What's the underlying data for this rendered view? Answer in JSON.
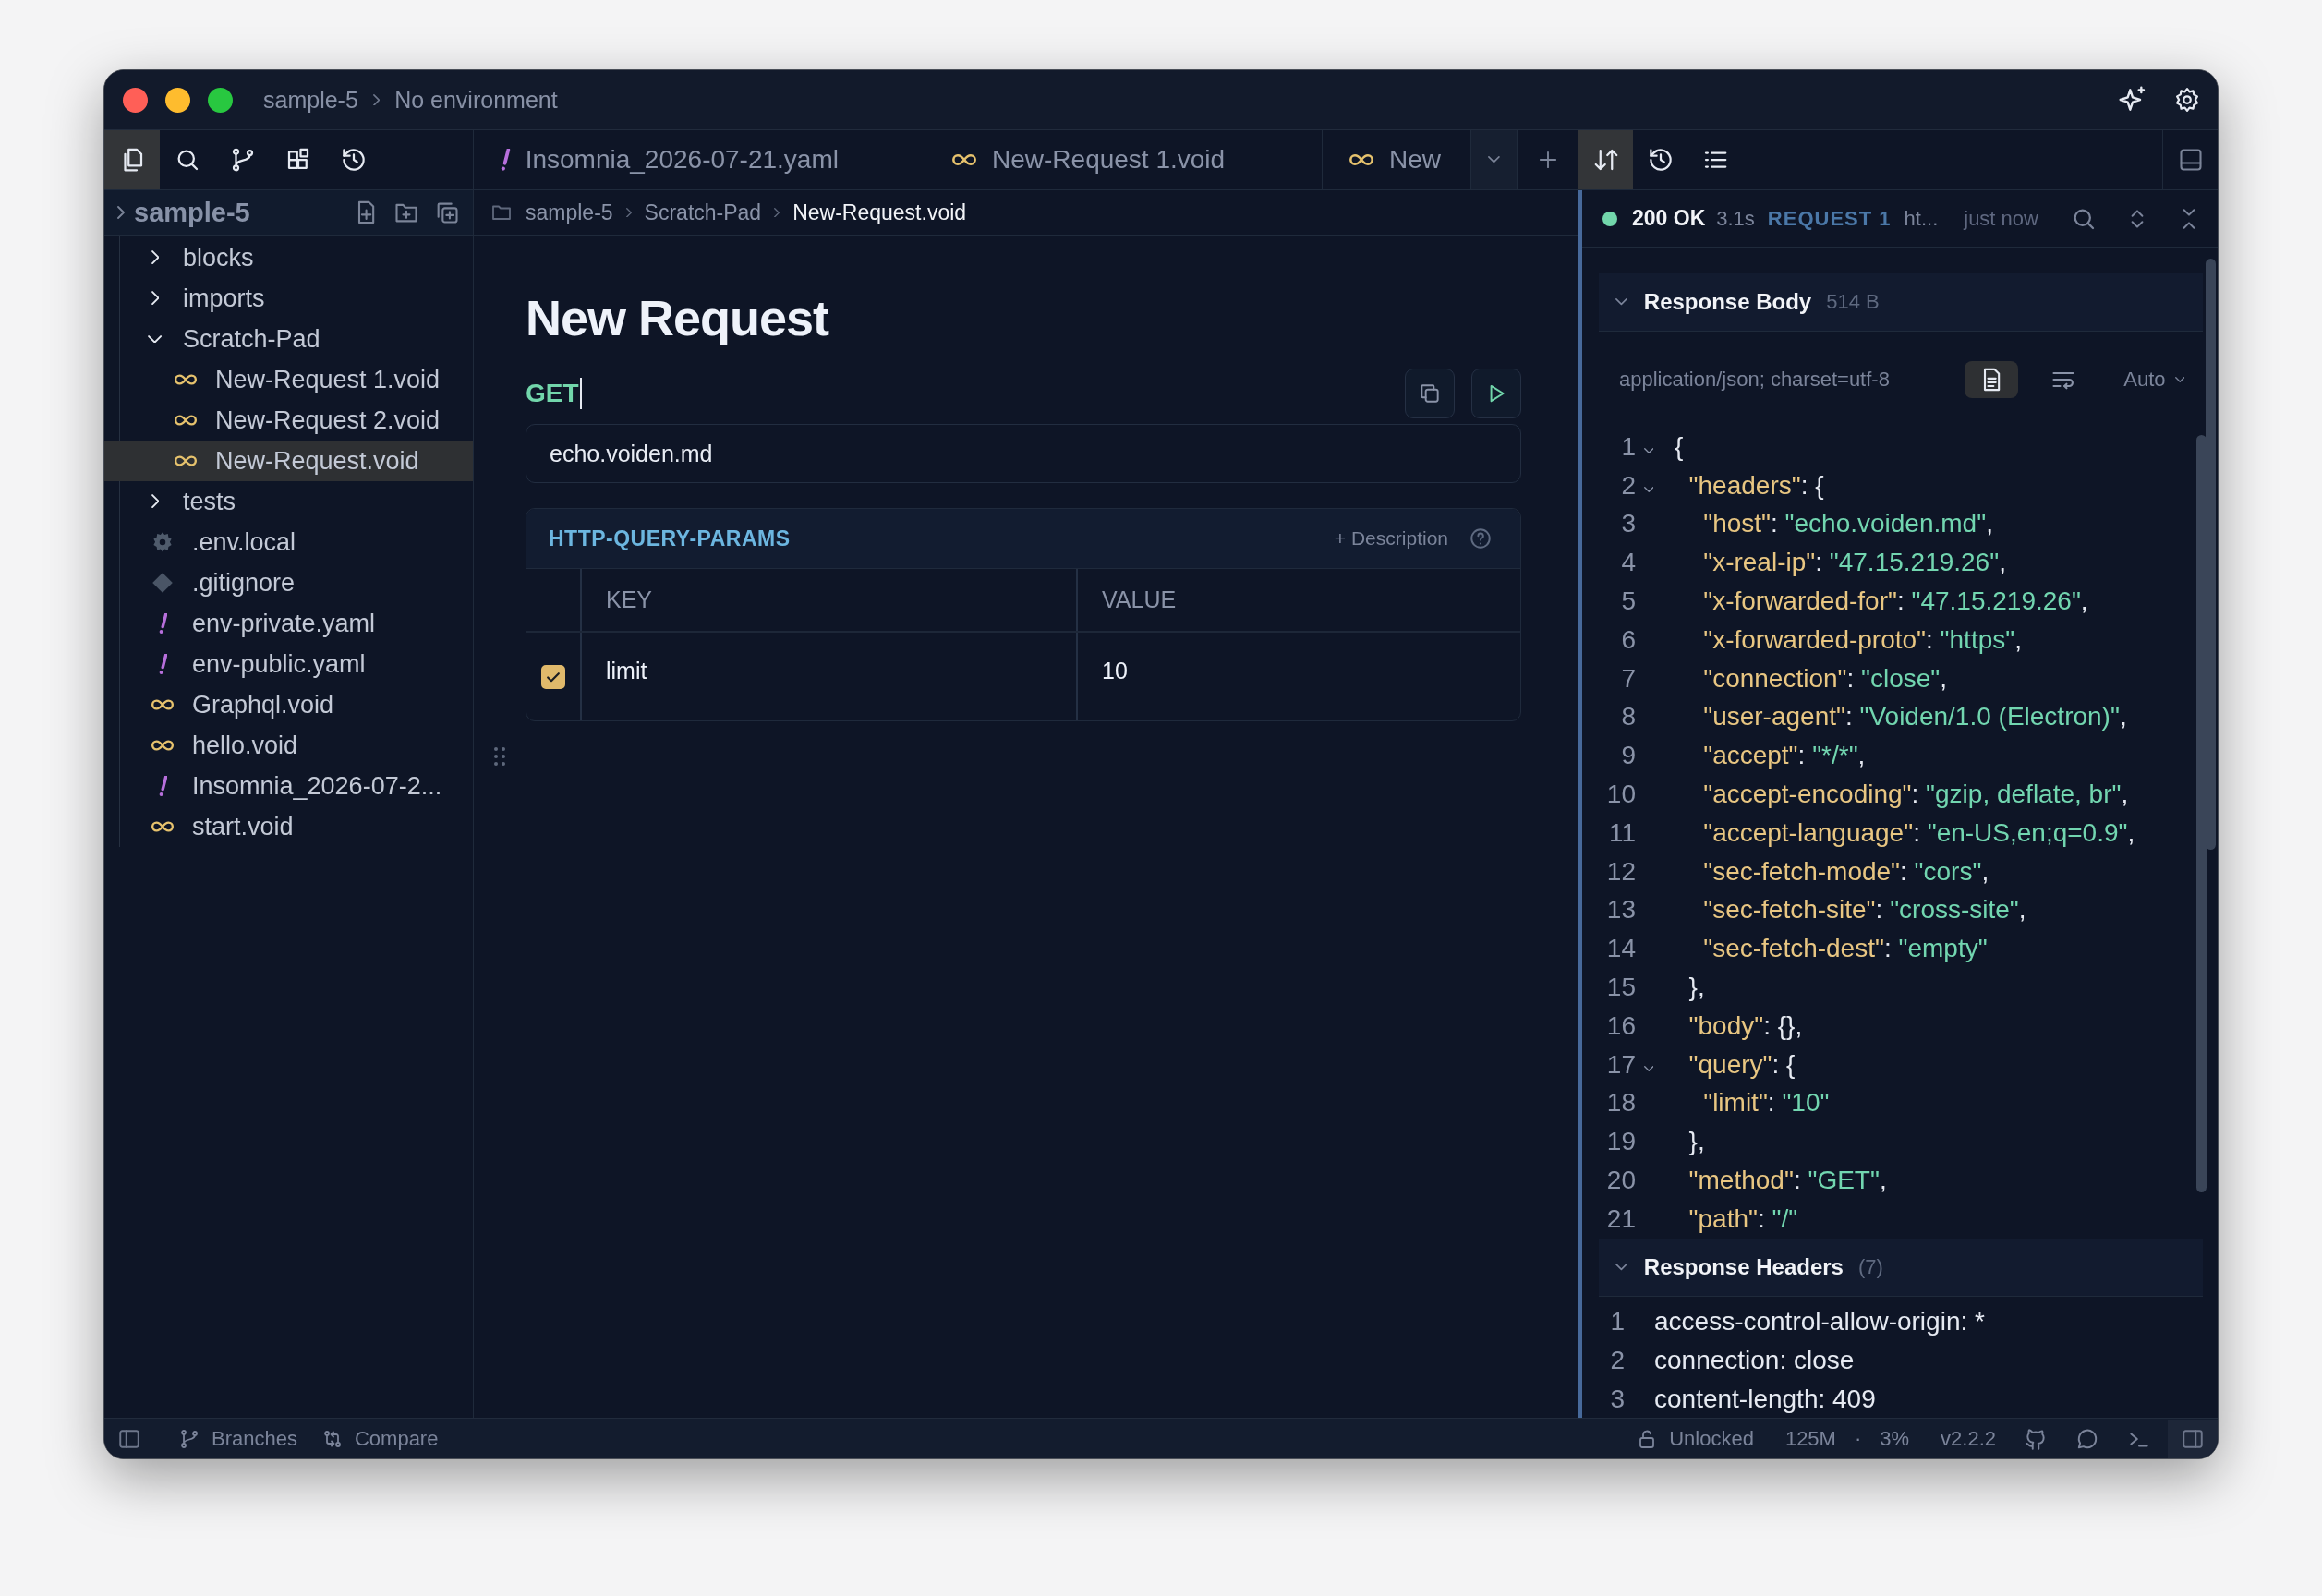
{
  "titlebar": {
    "project": "sample-5",
    "environment": "No environment"
  },
  "activity_bar": [
    {
      "kind": "files",
      "selected": true
    },
    {
      "kind": "search",
      "selected": false
    },
    {
      "kind": "branch",
      "selected": false
    },
    {
      "kind": "blocks",
      "selected": false
    },
    {
      "kind": "history",
      "selected": false
    }
  ],
  "tabs": [
    {
      "kind": "yaml",
      "label": "Insomnia_2026-07-21.yaml"
    },
    {
      "kind": "void",
      "label": "New-Request 1.void"
    },
    {
      "kind": "void",
      "label": "New"
    }
  ],
  "panel_tabs": [
    {
      "kind": "exchange",
      "selected": true
    },
    {
      "kind": "history",
      "selected": false
    },
    {
      "kind": "list",
      "selected": false
    }
  ],
  "sidebar": {
    "root": "sample-5",
    "expanded": false,
    "tree": [
      {
        "kind": "folder",
        "label": "blocks",
        "expanded": false,
        "selected": false
      },
      {
        "kind": "folder",
        "label": "imports",
        "expanded": false,
        "selected": false
      },
      {
        "kind": "folder",
        "label": "Scratch-Pad",
        "expanded": true,
        "selected": false,
        "children": [
          {
            "kind": "void",
            "label": "New-Request 1.void",
            "selected": false
          },
          {
            "kind": "void",
            "label": "New-Request 2.void",
            "selected": false
          },
          {
            "kind": "void",
            "label": "New-Request.void",
            "selected": true
          }
        ]
      },
      {
        "kind": "folder",
        "label": "tests",
        "expanded": false,
        "selected": false
      },
      {
        "kind": "env",
        "label": ".env.local",
        "selected": false
      },
      {
        "kind": "git",
        "label": ".gitignore",
        "selected": false
      },
      {
        "kind": "yaml",
        "label": "env-private.yaml",
        "selected": false
      },
      {
        "kind": "yaml",
        "label": "env-public.yaml",
        "selected": false
      },
      {
        "kind": "void",
        "label": "Graphql.void",
        "selected": false
      },
      {
        "kind": "void",
        "label": "hello.void",
        "selected": false
      },
      {
        "kind": "yaml",
        "label": "Insomnia_2026-07-2...",
        "selected": false
      },
      {
        "kind": "void",
        "label": "start.void",
        "selected": false
      }
    ]
  },
  "breadcrumb": [
    "sample-5",
    "Scratch-Pad",
    "New-Request.void"
  ],
  "request": {
    "title": "New Request",
    "method": "GET",
    "url": "echo.voiden.md",
    "params": {
      "title": "HTTP-QUERY-PARAMS",
      "description_link": "+ Description",
      "columns": [
        "KEY",
        "VALUE"
      ],
      "rows": [
        {
          "enabled": true,
          "key": "limit",
          "value": "10"
        }
      ]
    }
  },
  "response": {
    "status": "200 OK",
    "time": "3.1s",
    "request": "REQUEST 1",
    "url": "ht...",
    "when": "just now",
    "body": {
      "title": "Response Body",
      "size": "514 B",
      "expanded": true,
      "content_type": "application/json; charset=utf-8",
      "view_modes": [
        {
          "kind": "document",
          "selected": true
        },
        {
          "kind": "wrap",
          "selected": false
        }
      ],
      "format": "Auto",
      "lines": [
        {
          "number": "1",
          "fold": true,
          "tokens": [
            {
              "kind": "plain",
              "text": "{"
            }
          ]
        },
        {
          "number": "2",
          "fold": true,
          "tokens": [
            {
              "kind": "key",
              "text": "\"headers\""
            },
            {
              "kind": "plain",
              "text": ": {"
            }
          ]
        },
        {
          "number": "3",
          "fold": false,
          "tokens": [
            {
              "kind": "key",
              "text": "\"host\""
            },
            {
              "kind": "plain",
              "text": ": "
            },
            {
              "kind": "string",
              "text": "\"echo.voiden.md\""
            },
            {
              "kind": "plain",
              "text": ","
            }
          ]
        },
        {
          "number": "4",
          "fold": false,
          "tokens": [
            {
              "kind": "key",
              "text": "\"x-real-ip\""
            },
            {
              "kind": "plain",
              "text": ": "
            },
            {
              "kind": "string",
              "text": "\"47.15.219.26\""
            },
            {
              "kind": "plain",
              "text": ","
            }
          ]
        },
        {
          "number": "5",
          "fold": false,
          "tokens": [
            {
              "kind": "key",
              "text": "\"x-forwarded-for\""
            },
            {
              "kind": "plain",
              "text": ": "
            },
            {
              "kind": "string",
              "text": "\"47.15.219.26\""
            },
            {
              "kind": "plain",
              "text": ","
            }
          ]
        },
        {
          "number": "6",
          "fold": false,
          "tokens": [
            {
              "kind": "key",
              "text": "\"x-forwarded-proto\""
            },
            {
              "kind": "plain",
              "text": ": "
            },
            {
              "kind": "string",
              "text": "\"https\""
            },
            {
              "kind": "plain",
              "text": ","
            }
          ]
        },
        {
          "number": "7",
          "fold": false,
          "tokens": [
            {
              "kind": "key",
              "text": "\"connection\""
            },
            {
              "kind": "plain",
              "text": ": "
            },
            {
              "kind": "string",
              "text": "\"close\""
            },
            {
              "kind": "plain",
              "text": ","
            }
          ]
        },
        {
          "number": "8",
          "fold": false,
          "tokens": [
            {
              "kind": "key",
              "text": "\"user-agent\""
            },
            {
              "kind": "plain",
              "text": ": "
            },
            {
              "kind": "string",
              "text": "\"Voiden/1.0 (Electron)\""
            },
            {
              "kind": "plain",
              "text": ","
            }
          ]
        },
        {
          "number": "9",
          "fold": false,
          "tokens": [
            {
              "kind": "key",
              "text": "\"accept\""
            },
            {
              "kind": "plain",
              "text": ": "
            },
            {
              "kind": "string",
              "text": "\"*/*\""
            },
            {
              "kind": "plain",
              "text": ","
            }
          ]
        },
        {
          "number": "10",
          "fold": false,
          "tokens": [
            {
              "kind": "key",
              "text": "\"accept-encoding\""
            },
            {
              "kind": "plain",
              "text": ": "
            },
            {
              "kind": "string",
              "text": "\"gzip, deflate, br\""
            },
            {
              "kind": "plain",
              "text": ","
            }
          ]
        },
        {
          "number": "11",
          "fold": false,
          "tokens": [
            {
              "kind": "key",
              "text": "\"accept-language\""
            },
            {
              "kind": "plain",
              "text": ": "
            },
            {
              "kind": "string",
              "text": "\"en-US,en;q=0.9\""
            },
            {
              "kind": "plain",
              "text": ","
            }
          ]
        },
        {
          "number": "12",
          "fold": false,
          "tokens": [
            {
              "kind": "key",
              "text": "\"sec-fetch-mode\""
            },
            {
              "kind": "plain",
              "text": ": "
            },
            {
              "kind": "string",
              "text": "\"cors\""
            },
            {
              "kind": "plain",
              "text": ","
            }
          ]
        },
        {
          "number": "13",
          "fold": false,
          "tokens": [
            {
              "kind": "key",
              "text": "\"sec-fetch-site\""
            },
            {
              "kind": "plain",
              "text": ": "
            },
            {
              "kind": "string",
              "text": "\"cross-site\""
            },
            {
              "kind": "plain",
              "text": ","
            }
          ]
        },
        {
          "number": "14",
          "fold": false,
          "tokens": [
            {
              "kind": "key",
              "text": "\"sec-fetch-dest\""
            },
            {
              "kind": "plain",
              "text": ": "
            },
            {
              "kind": "string",
              "text": "\"empty\""
            }
          ]
        },
        {
          "number": "15",
          "fold": false,
          "tokens": [
            {
              "kind": "plain",
              "text": "},"
            }
          ]
        },
        {
          "number": "16",
          "fold": false,
          "tokens": [
            {
              "kind": "key",
              "text": "\"body\""
            },
            {
              "kind": "plain",
              "text": ": {},"
            }
          ]
        },
        {
          "number": "17",
          "fold": true,
          "tokens": [
            {
              "kind": "key",
              "text": "\"query\""
            },
            {
              "kind": "plain",
              "text": ": {"
            }
          ]
        },
        {
          "number": "18",
          "fold": false,
          "tokens": [
            {
              "kind": "key",
              "text": "\"limit\""
            },
            {
              "kind": "plain",
              "text": ": "
            },
            {
              "kind": "string",
              "text": "\"10\""
            }
          ]
        },
        {
          "number": "19",
          "fold": false,
          "tokens": [
            {
              "kind": "plain",
              "text": "},"
            }
          ]
        },
        {
          "number": "20",
          "fold": false,
          "tokens": [
            {
              "kind": "key",
              "text": "\"method\""
            },
            {
              "kind": "plain",
              "text": ": "
            },
            {
              "kind": "string",
              "text": "\"GET\""
            },
            {
              "kind": "plain",
              "text": ","
            }
          ]
        },
        {
          "number": "21",
          "fold": false,
          "tokens": [
            {
              "kind": "key",
              "text": "\"path\""
            },
            {
              "kind": "plain",
              "text": ": "
            },
            {
              "kind": "string",
              "text": "\"/\""
            }
          ]
        }
      ]
    },
    "headers": {
      "title": "Response Headers",
      "count": "(7)",
      "expanded": true,
      "lines": [
        {
          "number": "1",
          "text": "access-control-allow-origin: *"
        },
        {
          "number": "2",
          "text": "connection: close"
        },
        {
          "number": "3",
          "text": "content-length: 409"
        }
      ]
    }
  },
  "status_bar": {
    "left": [
      {
        "kind": "branch",
        "label": "Branches"
      },
      {
        "kind": "compare",
        "label": "Compare"
      }
    ],
    "lock": "Unlocked",
    "memory": "125M",
    "separator": "·",
    "cpu": "3%",
    "version": "v2.2.2"
  }
}
